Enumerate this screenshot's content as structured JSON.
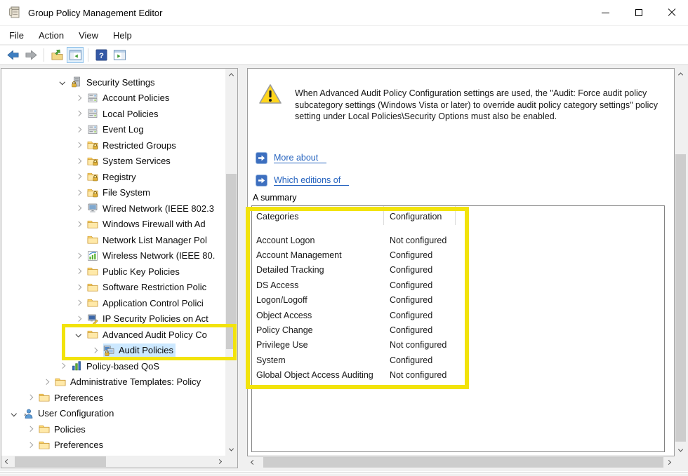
{
  "window": {
    "title": "Group Policy Management Editor"
  },
  "menu": {
    "items": [
      "File",
      "Action",
      "View",
      "Help"
    ]
  },
  "toolbar": {
    "buttons": [
      {
        "icon": "back"
      },
      {
        "icon": "forward"
      },
      {
        "icon": "export-list",
        "divider_before": true
      },
      {
        "icon": "console-tree",
        "active": true
      },
      {
        "icon": "help",
        "divider_before": true
      },
      {
        "icon": "extended-view"
      }
    ]
  },
  "tree": {
    "items": [
      {
        "label": "Security Settings",
        "level": 3,
        "expander": "open",
        "icon": "security-settings"
      },
      {
        "label": "Account Policies",
        "level": 4,
        "expander": "closed",
        "icon": "policy-group"
      },
      {
        "label": "Local Policies",
        "level": 4,
        "expander": "closed",
        "icon": "policy-group"
      },
      {
        "label": "Event Log",
        "level": 4,
        "expander": "closed",
        "icon": "policy-group"
      },
      {
        "label": "Restricted Groups",
        "level": 4,
        "expander": "closed",
        "icon": "folder-lock"
      },
      {
        "label": "System Services",
        "level": 4,
        "expander": "closed",
        "icon": "folder-lock"
      },
      {
        "label": "Registry",
        "level": 4,
        "expander": "closed",
        "icon": "folder-lock"
      },
      {
        "label": "File System",
        "level": 4,
        "expander": "closed",
        "icon": "folder-lock"
      },
      {
        "label": "Wired Network (IEEE 802.3",
        "level": 4,
        "expander": "closed",
        "icon": "wired-network"
      },
      {
        "label": "Windows Firewall with Ad",
        "level": 4,
        "expander": "closed",
        "icon": "folder"
      },
      {
        "label": "Network List Manager Pol",
        "level": 4,
        "expander": "none",
        "icon": "folder"
      },
      {
        "label": "Wireless Network (IEEE 80.",
        "level": 4,
        "expander": "closed",
        "icon": "wireless-network"
      },
      {
        "label": "Public Key Policies",
        "level": 4,
        "expander": "closed",
        "icon": "folder"
      },
      {
        "label": "Software Restriction Polic",
        "level": 4,
        "expander": "closed",
        "icon": "folder"
      },
      {
        "label": "Application Control Polici",
        "level": 4,
        "expander": "closed",
        "icon": "folder"
      },
      {
        "label": "IP Security Policies on Act",
        "level": 4,
        "expander": "closed",
        "icon": "ipsec"
      },
      {
        "label": "Advanced Audit Policy Co",
        "level": 4,
        "expander": "open",
        "icon": "folder"
      },
      {
        "label": "Audit Policies",
        "level": 5,
        "expander": "closed",
        "icon": "audit-policies",
        "selected": true
      },
      {
        "label": "Policy-based QoS",
        "level": 3,
        "expander": "closed",
        "icon": "qos"
      },
      {
        "label": "Administrative Templates: Policy",
        "level": 2,
        "expander": "closed",
        "icon": "folder"
      },
      {
        "label": "Preferences",
        "level": 1,
        "expander": "closed",
        "icon": "folder"
      },
      {
        "label": "User Configuration",
        "level": 0,
        "expander": "open",
        "icon": "user-configuration"
      },
      {
        "label": "Policies",
        "level": 1,
        "expander": "closed",
        "icon": "folder"
      },
      {
        "label": "Preferences",
        "level": 1,
        "expander": "closed",
        "icon": "folder"
      }
    ]
  },
  "detail": {
    "warning_text": "When Advanced Audit Policy Configuration settings are used, the \"Audit: Force audit policy subcategory settings (Windows Vista or later) to override audit policy category settings\" policy setting under Local Policies\\Security Options must also be enabled.",
    "links": [
      {
        "label": "More about"
      },
      {
        "label": "Which editions of"
      }
    ],
    "summary_label": "A summary",
    "table": {
      "headers": [
        "Categories",
        "Configuration"
      ],
      "rows": [
        {
          "category": "Account Logon",
          "configuration": "Not configured"
        },
        {
          "category": "Account Management",
          "configuration": "Configured"
        },
        {
          "category": "Detailed Tracking",
          "configuration": "Configured"
        },
        {
          "category": "DS Access",
          "configuration": "Configured"
        },
        {
          "category": "Logon/Logoff",
          "configuration": "Configured"
        },
        {
          "category": "Object Access",
          "configuration": "Configured"
        },
        {
          "category": "Policy Change",
          "configuration": "Configured"
        },
        {
          "category": "Privilege Use",
          "configuration": "Not configured"
        },
        {
          "category": "System",
          "configuration": "Configured"
        },
        {
          "category": "Global Object Access Auditing",
          "configuration": "Not configured"
        }
      ]
    }
  },
  "colors": {
    "highlight_box": "#F2E30B",
    "tree_selection": "#CCE8FF",
    "link_blue": "#2563BF"
  }
}
